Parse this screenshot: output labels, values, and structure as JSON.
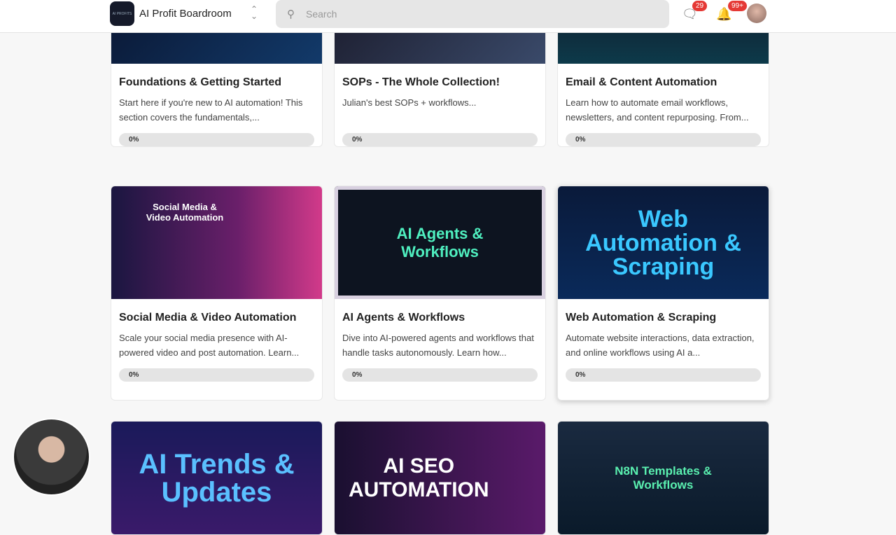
{
  "header": {
    "brand": "AI Profit Boardroom",
    "logo_text": "AI PROFITS",
    "search_placeholder": "Search",
    "chat_count": "29",
    "notif_count": "99+"
  },
  "courses": [
    {
      "title": "Foundations & Getting Started",
      "desc": "Start here if you're new to AI automation! This section covers the fundamentals,...",
      "progress": "0%"
    },
    {
      "title": "SOPs - The Whole Collection!",
      "desc": "Julian's best SOPs + workflows...",
      "progress": "0%"
    },
    {
      "title": "Email & Content Automation",
      "desc": "Learn how to automate email workflows, newsletters, and content repurposing. From...",
      "progress": "0%"
    },
    {
      "title": "Social Media & Video Automation",
      "banner": "Social Media & Video Automation",
      "desc": "Scale your social media presence with AI-powered video and post automation. Learn...",
      "progress": "0%"
    },
    {
      "title": "AI Agents & Workflows",
      "banner": "AI Agents & Workflows",
      "desc": "Dive into AI-powered agents and workflows that handle tasks autonomously. Learn how...",
      "progress": "0%"
    },
    {
      "title": "Web Automation & Scraping",
      "banner": "Web Automation & Scraping",
      "desc": "Automate website interactions, data extraction, and online workflows using AI a...",
      "progress": "0%"
    },
    {
      "banner": "AI Trends & Updates"
    },
    {
      "banner": "AI SEO AUTOMATION"
    },
    {
      "banner": "N8N Templates & Workflows"
    }
  ]
}
